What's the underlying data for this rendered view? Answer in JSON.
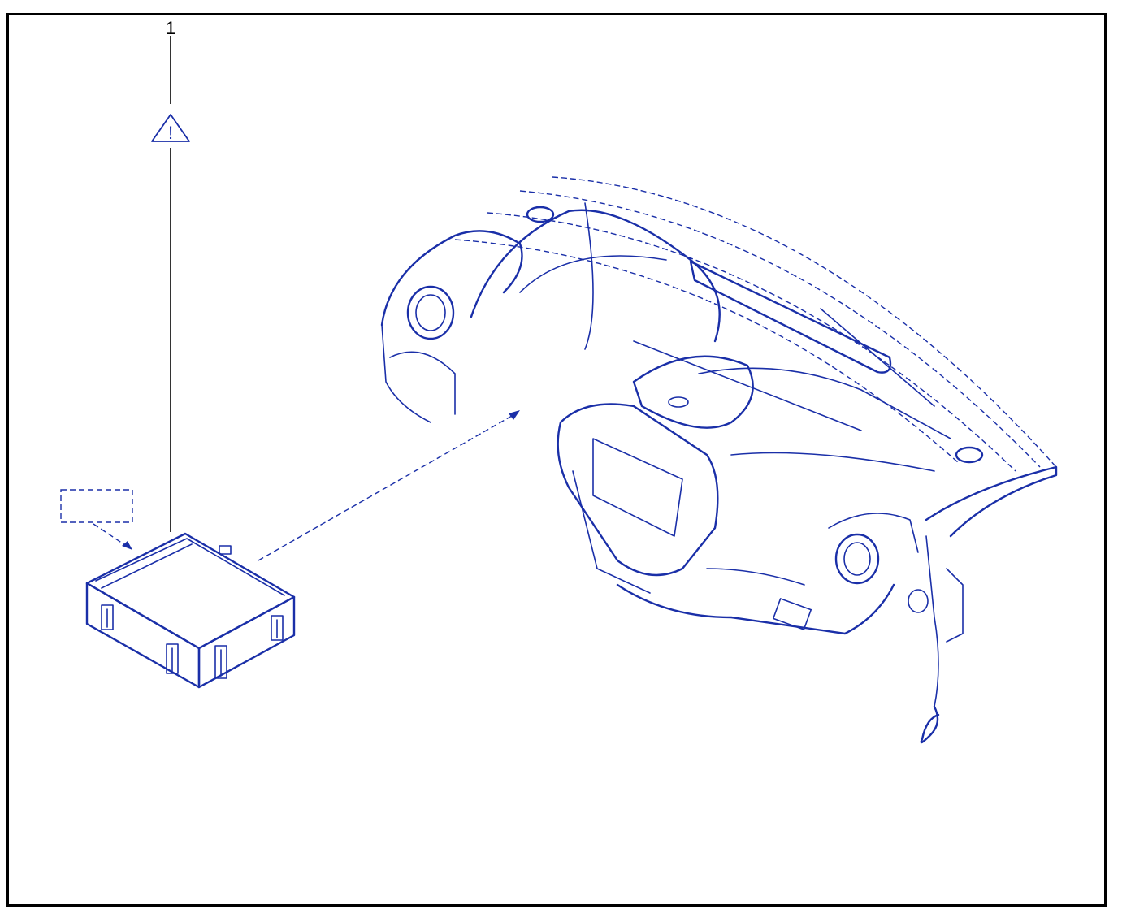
{
  "callout": {
    "number": "1"
  },
  "warning": {
    "icon": "warning-triangle-icon",
    "glyph": "!"
  },
  "colors": {
    "line": "#1a2fa8",
    "frame": "#000000"
  }
}
